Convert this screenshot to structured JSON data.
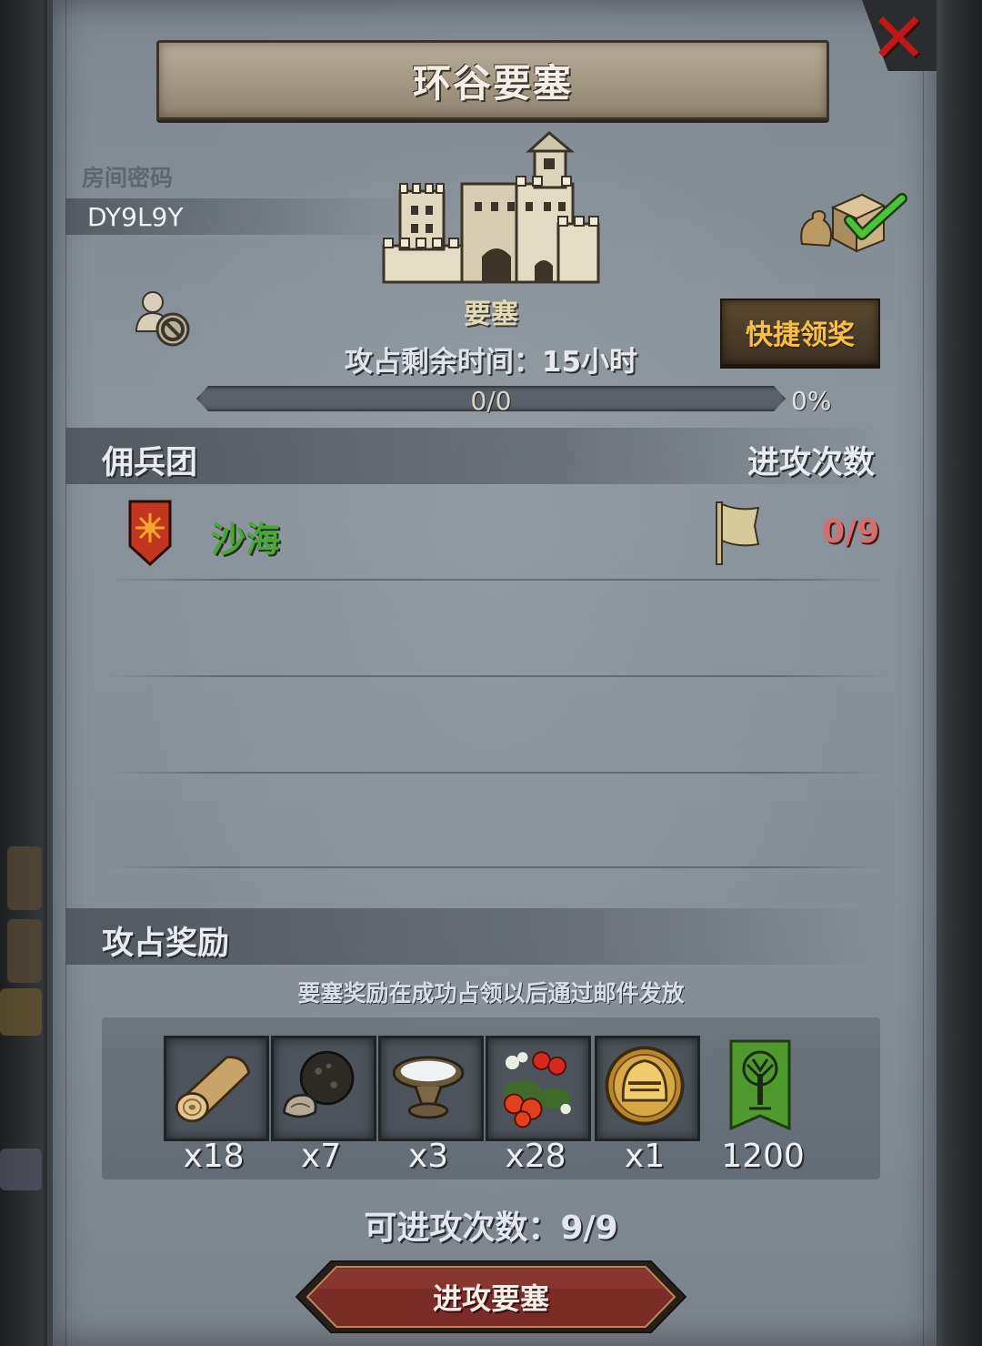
{
  "title": "环谷要塞",
  "room": {
    "label": "房间密码",
    "code": "DY9L9Y"
  },
  "fortress": {
    "name": "要塞",
    "timer_label": "攻占剩余时间：",
    "timer_value": "15小时",
    "progress_text": "0/0",
    "progress_percent": "0%",
    "progress_fraction": 0
  },
  "quick_claim_label": "快捷领奖",
  "mercenary": {
    "header_left": "佣兵团",
    "header_right": "进攻次数",
    "entries": [
      {
        "name": "沙海",
        "attacks": "0/9",
        "name_color": "#4aa53a"
      }
    ]
  },
  "rewards": {
    "header": "攻占奖励",
    "note": "要塞奖励在成功占领以后通过邮件发放",
    "items": [
      {
        "icon": "wood-log-icon",
        "qty": "x18"
      },
      {
        "icon": "truffle-icon",
        "qty": "x7"
      },
      {
        "icon": "salt-dish-icon",
        "qty": "x3"
      },
      {
        "icon": "berries-icon",
        "qty": "x28"
      },
      {
        "icon": "knight-helmet-coin-icon",
        "qty": "x1"
      },
      {
        "icon": "tree-banner-icon",
        "qty": "1200"
      }
    ]
  },
  "attempts": "可进攻次数：9/9",
  "attack_button_label": "进攻要塞",
  "colors": {
    "accent_gold": "#f5bf4a",
    "merc_green": "#4aa53a",
    "attack_count_red": "#d86d6d",
    "close_red": "#c01818"
  }
}
